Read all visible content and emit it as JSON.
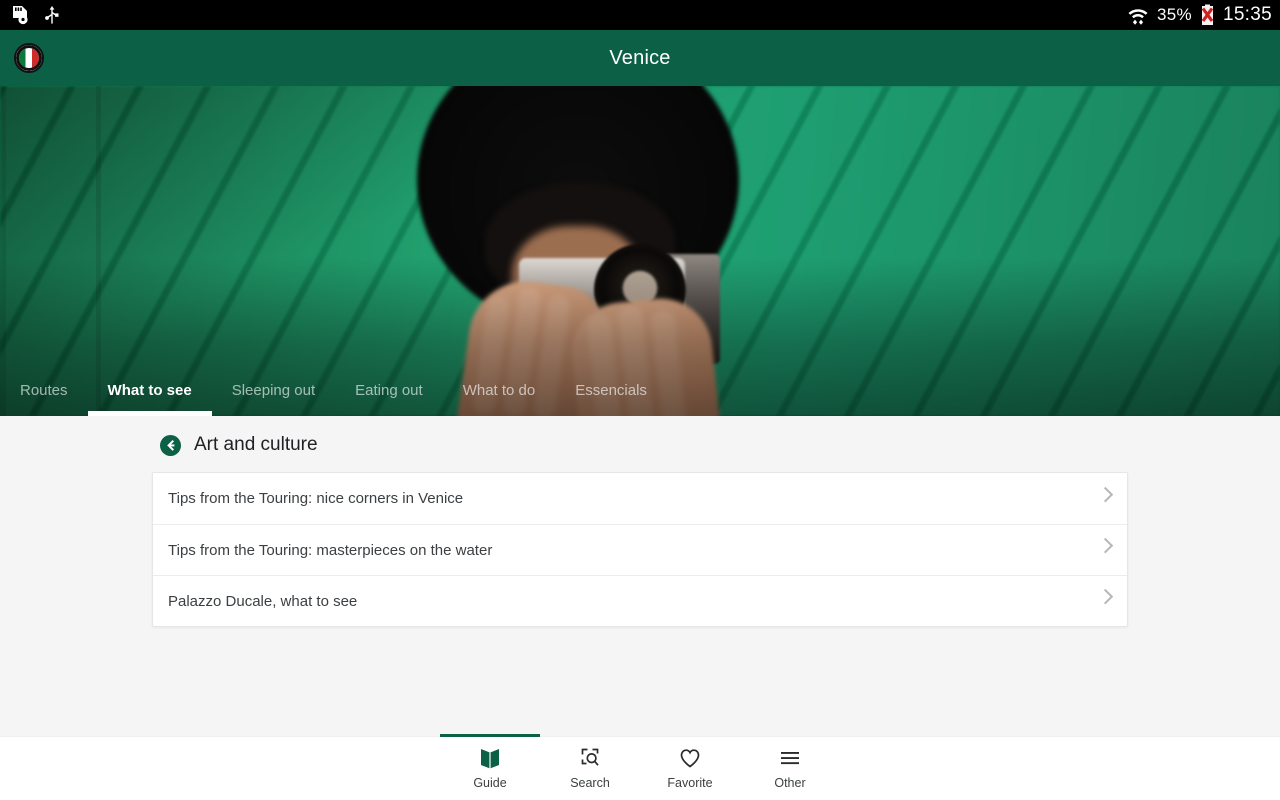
{
  "statusbar": {
    "left_icons": [
      "sd-card-settings-icon",
      "usb-icon"
    ],
    "battery_percent": "35%",
    "time": "15:35",
    "right_icons": [
      "wifi-transfer-icon",
      "battery-error-icon"
    ]
  },
  "appbar": {
    "title": "Venice",
    "logo": "touring-club-logo"
  },
  "tabs": [
    {
      "label": "Routes",
      "active": false
    },
    {
      "label": "What to see",
      "active": true
    },
    {
      "label": "Sleeping out",
      "active": false
    },
    {
      "label": "Eating out",
      "active": false
    },
    {
      "label": "What to do",
      "active": false
    },
    {
      "label": "Essencials",
      "active": false
    }
  ],
  "section": {
    "back_icon": "back-circle-icon",
    "title": "Art and culture"
  },
  "list": [
    {
      "label": "Tips from the Touring: nice corners in Venice"
    },
    {
      "label": "Tips from the Touring: masterpieces on the water"
    },
    {
      "label": "Palazzo Ducale, what to see"
    }
  ],
  "bottomnav": [
    {
      "label": "Guide",
      "icon": "book-icon",
      "active": true
    },
    {
      "label": "Search",
      "icon": "search-frame-icon",
      "active": false
    },
    {
      "label": "Favorite",
      "icon": "heart-icon",
      "active": false
    },
    {
      "label": "Other",
      "icon": "hamburger-menu-icon",
      "active": false
    }
  ],
  "colors": {
    "brand_green": "#0b6045",
    "hero_green": "#12996a",
    "content_bg": "#f5f5f5",
    "card_bg": "#ffffff",
    "text_primary": "#3c4043"
  }
}
